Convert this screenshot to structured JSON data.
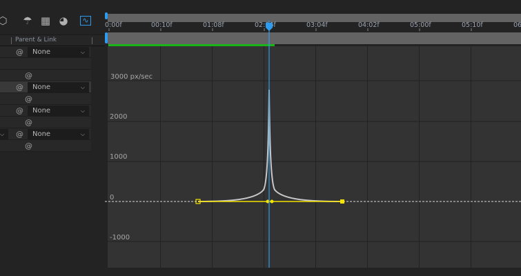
{
  "toolbar": {
    "icons": [
      "3d-layer-icon",
      "comp-marker-icon",
      "frame-blend-icon",
      "motion-blur-icon",
      "graph-editor-icon"
    ]
  },
  "columns": {
    "parent_link": "Parent & Link"
  },
  "layers": [
    {
      "parent": "None",
      "highlighted": false
    },
    {
      "parent": "None",
      "highlighted": true
    },
    {
      "parent": "None",
      "highlighted": false
    },
    {
      "parent": "None",
      "highlighted": false
    }
  ],
  "ruler": {
    "labels": [
      "0:00f",
      "00:10f",
      "01:08f",
      "02:06f",
      "03:04f",
      "04:02f",
      "05:00f",
      "05:10f",
      "06"
    ]
  },
  "graph": {
    "unit_label": "3000 px/sec",
    "y_labels": [
      "2000",
      "1000",
      "0",
      "-1000"
    ],
    "peak_value": 2750,
    "colors": {
      "playhead": "#2d9cf0",
      "keyframe": "#f5e300",
      "curve": "#c8c8c8",
      "work_area": "#18b418"
    }
  }
}
